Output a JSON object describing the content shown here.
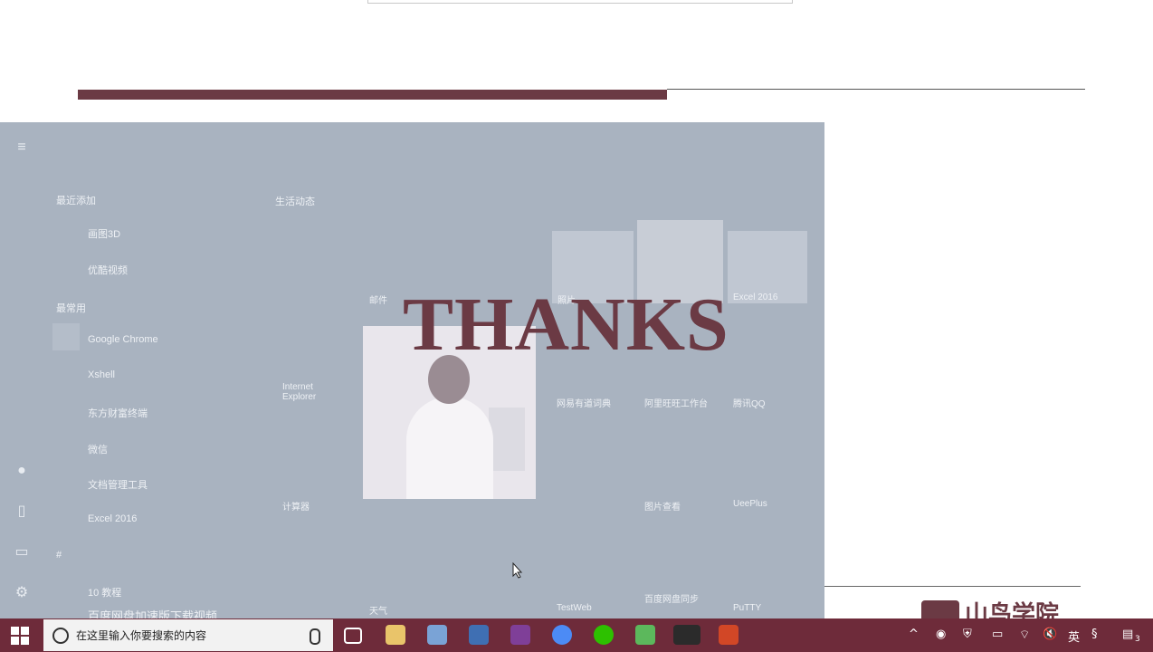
{
  "slide": {
    "title": "THANKS",
    "logo_text": "山鸟学院"
  },
  "start_menu": {
    "groups": [
      "最近添加",
      "最常用"
    ],
    "recent_items": [
      "画图3D",
      "优酷视频"
    ],
    "frequent_items": [
      "Google Chrome",
      "Xshell",
      "东方财富终端",
      "微信",
      "文档管理工具",
      "Excel 2016"
    ],
    "section_hash": "#",
    "section_label": "10 教程",
    "bottom_item": "百度网盘加速版下载视频",
    "tiles_group": "生活动态",
    "tiles": [
      "邮件",
      "照片",
      "Excel 2016",
      "Internet Explorer",
      "网易有道词典",
      "阿里旺旺工作台",
      "腾讯QQ",
      "计算器",
      "图片查看",
      "UeePlus",
      "TestWeb",
      "天气",
      "百度网盘同步",
      "PuTTY"
    ]
  },
  "taskbar": {
    "search_placeholder": "在这里输入你要搜索的内容",
    "lang": "英",
    "notif_count": "3"
  }
}
